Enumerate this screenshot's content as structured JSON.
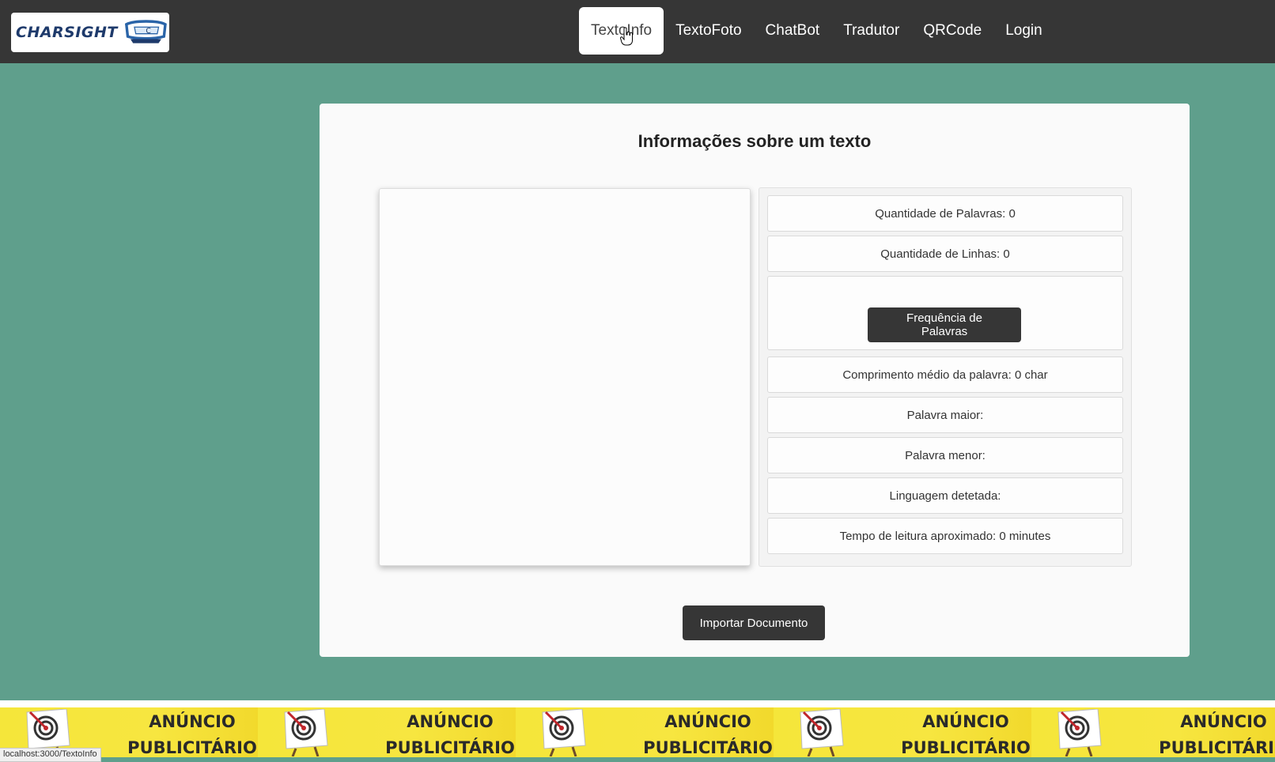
{
  "logo": {
    "text": "CHARSIGHT"
  },
  "nav": {
    "items": [
      {
        "label": "TextoInfo",
        "active": true
      },
      {
        "label": "TextoFoto"
      },
      {
        "label": "ChatBot"
      },
      {
        "label": "Tradutor"
      },
      {
        "label": "QRCode"
      },
      {
        "label": "Login"
      }
    ]
  },
  "main": {
    "title": "Informações sobre um texto",
    "text_input_value": "",
    "stats": {
      "word_count": "Quantidade de Palavras: 0",
      "line_count": "Quantidade de Linhas: 0",
      "word_frequency_button": "Frequência de Palavras",
      "avg_word_length": "Comprimento médio da palavra: 0 char",
      "longest_word": "Palavra maior:",
      "shortest_word": "Palavra menor:",
      "language": "Linguagem detetada:",
      "reading_time": "Tempo de leitura aproximado: 0 minutes"
    },
    "import_button": "Importar Documento"
  },
  "ad": {
    "line1": "ANÚNCIO",
    "line2": "PUBLICITÁRIO"
  },
  "status_bar": {
    "url": "localhost:3000/TextoInfo"
  },
  "colors": {
    "navbar": "#363636",
    "page_background": "#5f9f8c",
    "button_dark": "#363636",
    "ad_yellow": "#f5e63a"
  }
}
